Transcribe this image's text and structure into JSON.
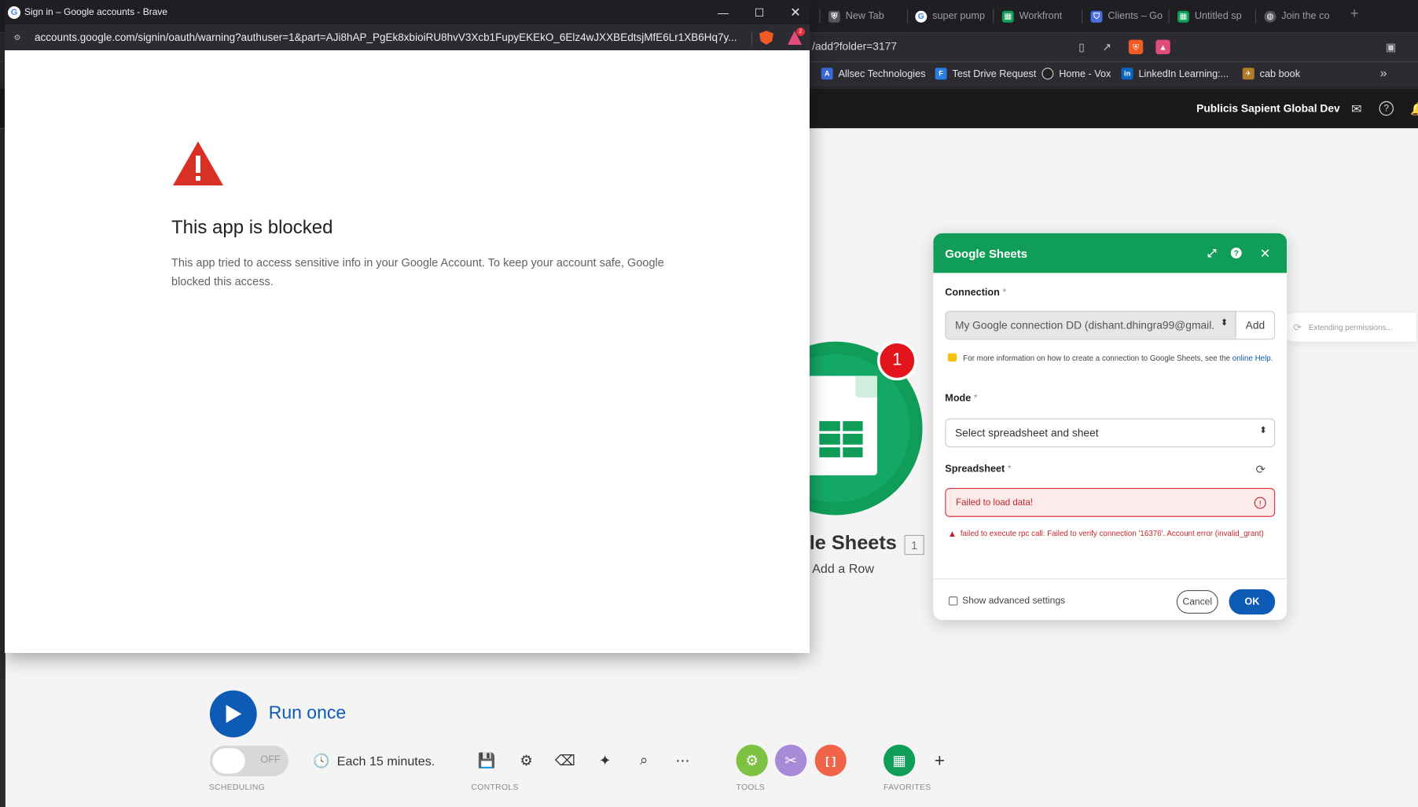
{
  "background_browser": {
    "tabs": [
      {
        "label": "New Tab",
        "icon": "brave-shield-icon",
        "color": "#6e6e78"
      },
      {
        "label": "super pump",
        "icon": "google-icon",
        "color": "#ffffff"
      },
      {
        "label": "Workfront",
        "icon": "sheets-icon",
        "color": "#0f9d58"
      },
      {
        "label": "Clients – Go",
        "icon": "shield-icon",
        "color": "#4a6ee0"
      },
      {
        "label": "Untitled sp",
        "icon": "sheets-icon",
        "color": "#0f9d58"
      },
      {
        "label": "Join the co",
        "icon": "globe-icon",
        "color": "#6e6e78"
      }
    ],
    "address_fragment": "/add?folder=3177",
    "bookmarks": [
      {
        "label": "Allsec Technologies",
        "color": "#3c6ad8"
      },
      {
        "label": "Test Drive Request",
        "color": "#2a7de1"
      },
      {
        "label": "Home - Vox",
        "color": "#222222"
      },
      {
        "label": "LinkedIn Learning:...",
        "color": "#0a66c2"
      },
      {
        "label": "cab book",
        "color": "#b07a2a"
      }
    ],
    "org_name": "Publicis Sapient Global Dev"
  },
  "module": {
    "badge": "1",
    "title": "le Sheets",
    "count": "1",
    "subtitle": "Add a Row",
    "color": "#0f9d58"
  },
  "toolbar": {
    "run_label": "Run once",
    "toggle_state": "OFF",
    "schedule_text": "Each 15 minutes.",
    "labels": {
      "scheduling": "SCHEDULING",
      "controls": "CONTROLS",
      "tools": "TOOLS",
      "favorites": "FAVORITES"
    },
    "tools_colors": [
      "#7dc242",
      "#a78bd8",
      "#f0654a"
    ],
    "tools_glyphs": [
      "⚙",
      "✂",
      "[ ]"
    ]
  },
  "dialog": {
    "title": "Google Sheets",
    "connection_label": "Connection",
    "required_mark": "*",
    "connection_value": "My Google connection DD (dishant.dhingra99@gmail.",
    "add_label": "Add",
    "extending_text": "Extending permissions...",
    "info_text": "For more information on how to create a connection to Google Sheets, see the",
    "info_link": "online Help.",
    "mode_label": "Mode",
    "mode_value": "Select spreadsheet and sheet",
    "spreadsheet_label": "Spreadsheet",
    "spreadsheet_error_value": "Failed to load data!",
    "error_message": "failed to execute rpc call: Failed to verify connection '16376'. Account error (invalid_grant)",
    "advanced_label": "Show advanced settings",
    "cancel_label": "Cancel",
    "ok_label": "OK",
    "header_color": "#0f9d58",
    "error_color": "#c0272d"
  },
  "popup": {
    "window_title": "Sign in – Google accounts - Brave",
    "url": "accounts.google.com/signin/oauth/warning?authuser=1&part=AJi8hAP_PgEk8xbioiRU8hvV3Xcb1FupyEKEkO_6Elz4wJXXBEdtsjMfE6Lr1XB6Hq7y...",
    "rewards_badge": "2",
    "heading": "This app is blocked",
    "message": "This app tried to access sensitive info in your Google Account. To keep your account safe, Google blocked this access.",
    "warning_color": "#d93025"
  }
}
